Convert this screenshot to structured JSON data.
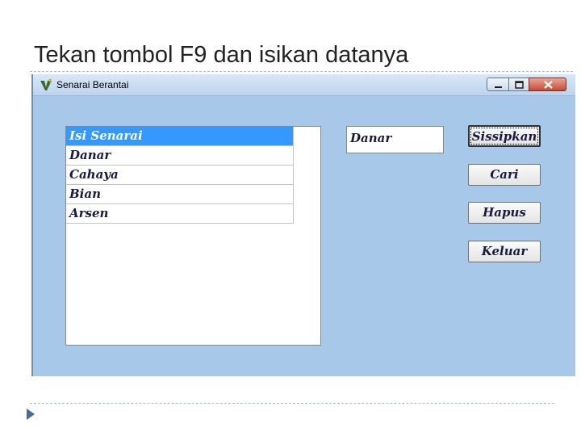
{
  "slide": {
    "title": "Tekan tombol F9 dan isikan datanya"
  },
  "window": {
    "title": "Senarai Berantai",
    "icon": "vb-app-icon"
  },
  "list": {
    "items": [
      "Isi Senarai",
      "Danar",
      "Cahaya",
      "Bian",
      "Arsen"
    ],
    "selected_index": 0
  },
  "input": {
    "value": "Danar"
  },
  "buttons": {
    "insert": "Sissipkan",
    "find": "Cari",
    "delete": "Hapus",
    "exit": "Keluar"
  },
  "colors": {
    "form_background": "#a8c8ea",
    "selection": "#3399ff",
    "close_button": "#c74a35"
  }
}
